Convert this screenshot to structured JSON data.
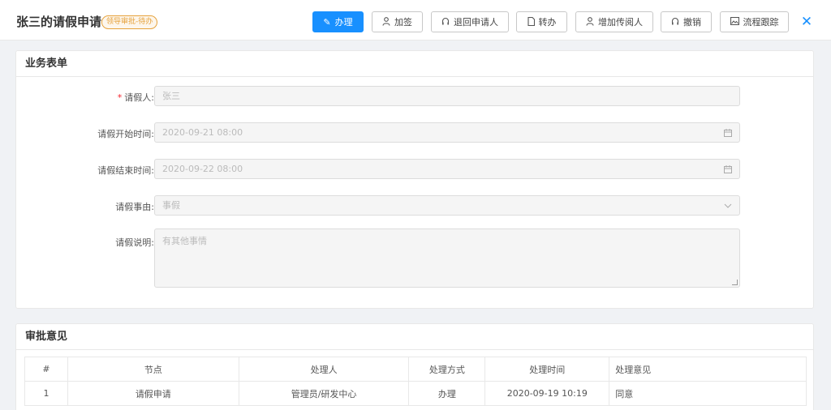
{
  "header": {
    "title": "张三的请假申请",
    "badge": "领导审批-待办",
    "buttons": {
      "handle": "办理",
      "add_sign": "加签",
      "return_applicant": "退回申请人",
      "transfer": "转办",
      "add_reader": "增加传阅人",
      "revoke": "撤销",
      "track": "流程跟踪"
    },
    "close": "✕"
  },
  "form": {
    "heading": "业务表单",
    "applicant_label": "请假人:",
    "applicant_value": "张三",
    "start_label": "请假开始时间:",
    "start_value": "2020-09-21 08:00",
    "end_label": "请假结束时间:",
    "end_value": "2020-09-22 08:00",
    "reason_label": "请假事由:",
    "reason_value": "事假",
    "desc_label": "请假说明:",
    "desc_value": "有其他事情"
  },
  "approval": {
    "heading": "审批意见",
    "columns": [
      "#",
      "节点",
      "处理人",
      "处理方式",
      "处理时间",
      "处理意见"
    ],
    "rows": [
      [
        "1",
        "请假申请",
        "管理员/研发中心",
        "办理",
        "2020-09-19 10:19",
        "同意"
      ]
    ]
  },
  "colors": {
    "primary": "#1890ff",
    "badge": "#e6a23c",
    "required": "#f5222d"
  }
}
